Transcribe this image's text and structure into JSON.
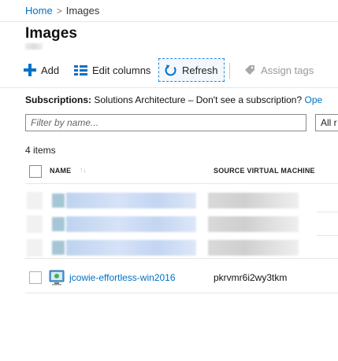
{
  "breadcrumb": {
    "home": "Home",
    "separator": ">",
    "current": "Images"
  },
  "page": {
    "title": "Images"
  },
  "toolbar": {
    "add_label": "Add",
    "edit_columns_label": "Edit columns",
    "refresh_label": "Refresh",
    "assign_tags_label": "Assign tags"
  },
  "subscriptions": {
    "label": "Subscriptions:",
    "value": "Solutions Architecture – Don't see a subscription?",
    "link": "Ope"
  },
  "filter": {
    "placeholder": "Filter by name...",
    "value": ""
  },
  "type_select": {
    "value": "All r"
  },
  "list": {
    "count_text": "4 items",
    "headers": {
      "name": "NAME",
      "source": "SOURCE VIRTUAL MACHINE"
    },
    "rows": [
      {
        "name": "jcowie-effortless-win2016",
        "source": "pkrvmr6i2wy3tkm",
        "icon": "vm-image-icon"
      }
    ]
  },
  "colors": {
    "accent": "#0072c6",
    "link": "#0072c6",
    "refresh_highlight": "#2b88d8"
  }
}
